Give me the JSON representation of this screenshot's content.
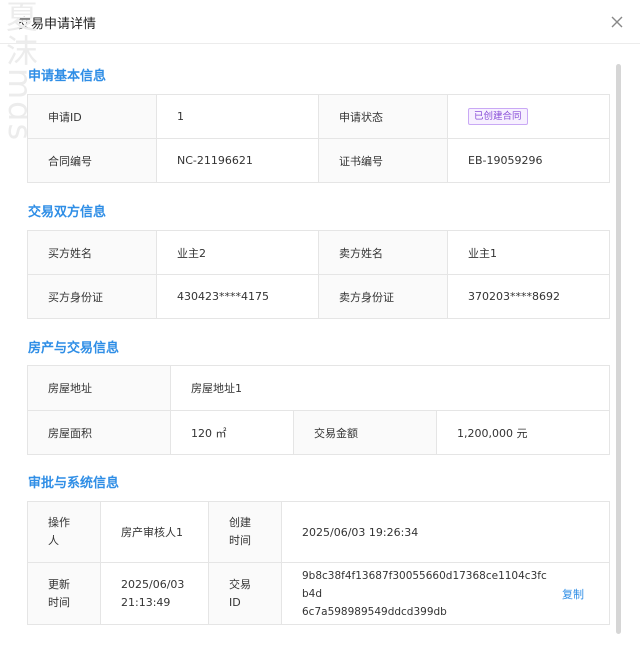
{
  "dialog": {
    "title": "交易申请详情",
    "watermark": "夏沫mds"
  },
  "sections": {
    "apply": {
      "title": "申请基本信息",
      "rows": [
        {
          "l1": "申请ID",
          "v1": "1",
          "l2": "申请状态",
          "v2": "已创建合同"
        },
        {
          "l1": "合同编号",
          "v1": "NC-21196621",
          "l2": "证书编号",
          "v2": "EB-19059296"
        }
      ]
    },
    "parties": {
      "title": "交易双方信息",
      "rows": [
        {
          "l1": "买方姓名",
          "v1": "业主2",
          "l2": "卖方姓名",
          "v2": "业主1"
        },
        {
          "l1": "买方身份证",
          "v1": "430423****4175",
          "l2": "卖方身份证",
          "v2": "370203****8692"
        }
      ]
    },
    "property": {
      "title": "房产与交易信息",
      "address_label": "房屋地址",
      "address_value": "房屋地址1",
      "area_label": "房屋面积",
      "area_value": "120 ㎡",
      "amount_label": "交易金额",
      "amount_value": "1,200,000 元"
    },
    "system": {
      "title": "审批与系统信息",
      "operator_label_1": "操作",
      "operator_label_2": "人",
      "operator_value": "房产审核人1",
      "created_label_1": "创建",
      "created_label_2": "时间",
      "created_value": "2025/06/03 19:26:34",
      "updated_label_1": "更新",
      "updated_label_2": "时间",
      "updated_value_1": "2025/06/03",
      "updated_value_2": "21:13:49",
      "txid_label_1": "交易",
      "txid_label_2": "ID",
      "txid_value_1": "9b8c38f4f13687f30055660d17368ce1104c3fcb4d",
      "txid_value_2": "6c7a598989549ddcd399db",
      "copy_label": "复制"
    }
  },
  "colors": {
    "accent": "#2f8ee6",
    "badge_text": "#8a4fd8",
    "badge_bg": "#f7f0ff"
  }
}
